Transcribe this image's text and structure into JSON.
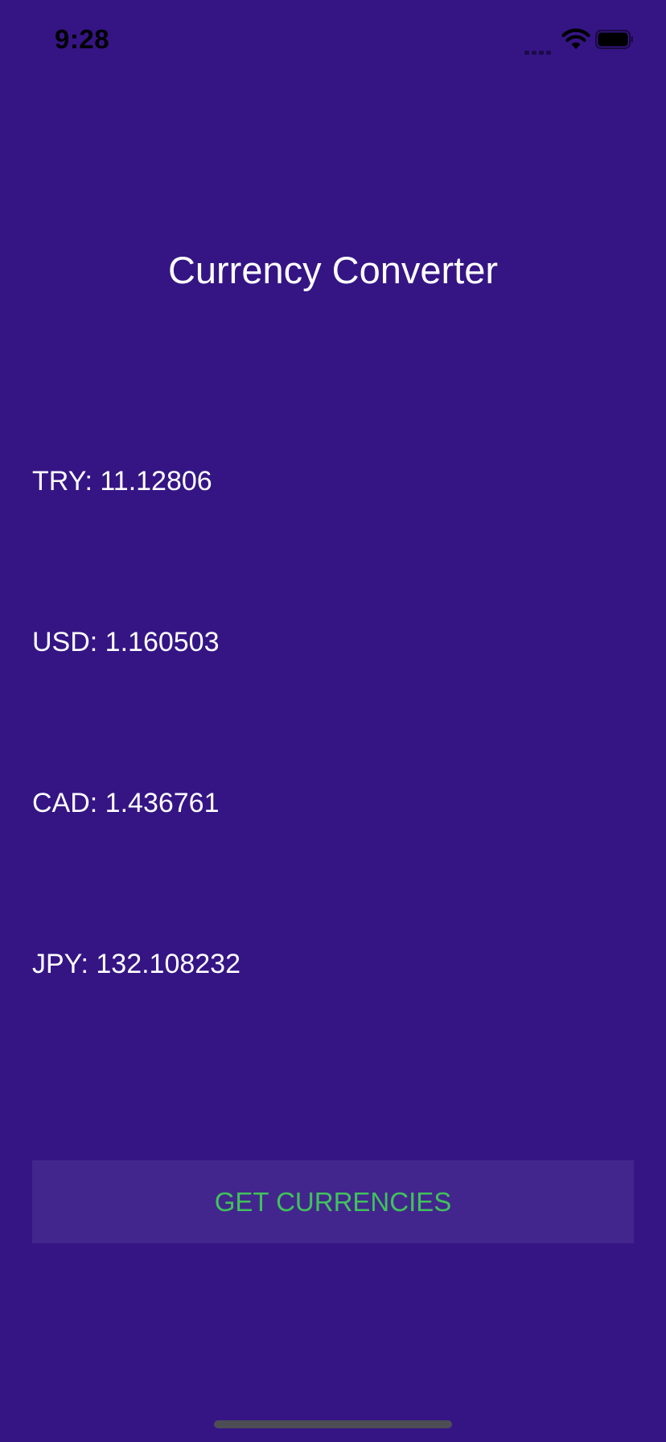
{
  "status_bar": {
    "time": "9:28",
    "icons": [
      "cellular-signal-icon",
      "wifi-icon",
      "battery-icon"
    ],
    "icon_color": "#000000"
  },
  "app": {
    "title": "Currency Converter",
    "background_color": "#351584"
  },
  "rates": [
    {
      "label": "TRY: 11.12806"
    },
    {
      "label": "USD: 1.160503"
    },
    {
      "label": "CAD: 1.436761"
    },
    {
      "label": "JPY: 132.108232"
    }
  ],
  "button": {
    "label": "GET CURRENCIES",
    "text_color": "#3fc35c",
    "background_color": "#43268d"
  }
}
